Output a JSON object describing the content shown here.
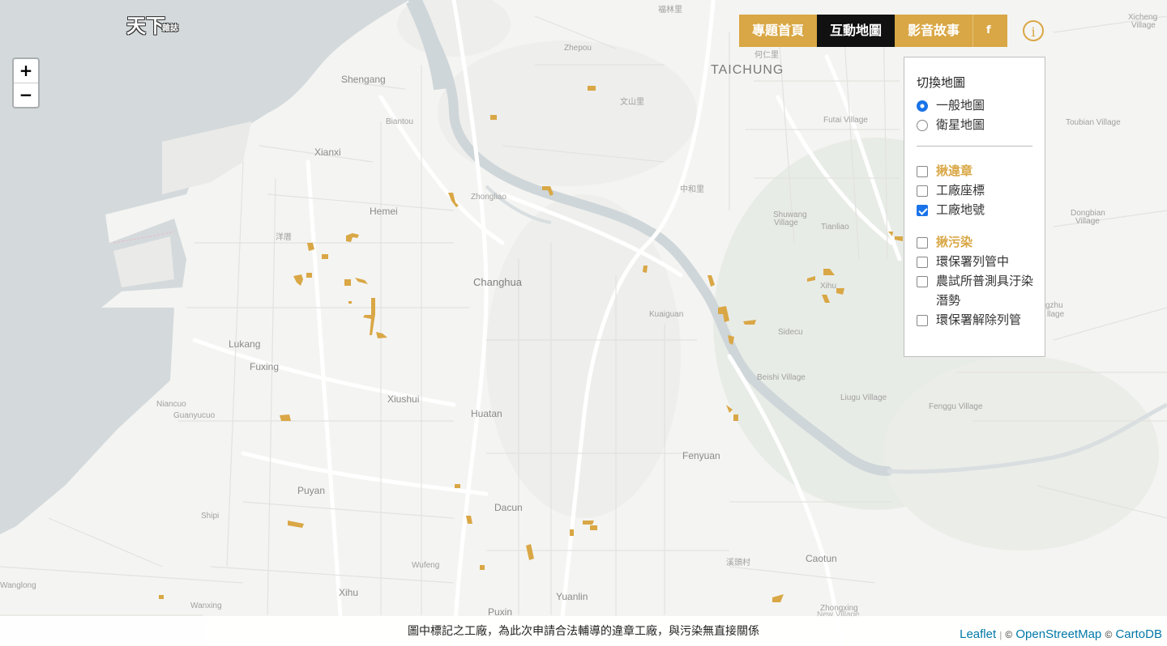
{
  "logo": {
    "main": "天下",
    "sub": "雜誌"
  },
  "zoom": {
    "in_label": "+",
    "out_label": "−"
  },
  "nav": {
    "items": [
      {
        "label": "專題首頁",
        "active": false
      },
      {
        "label": "互動地圖",
        "active": true
      },
      {
        "label": "影音故事",
        "active": false
      }
    ],
    "facebook_label": "f",
    "info_label": "i"
  },
  "layers": {
    "title": "切換地圖",
    "base_maps": [
      {
        "label": "一般地圖",
        "selected": true
      },
      {
        "label": "衛星地圖",
        "selected": false
      }
    ],
    "group1": {
      "label": "揪違章",
      "checked": false,
      "items": [
        {
          "label": "工廠座標",
          "checked": false
        },
        {
          "label": "工廠地號",
          "checked": true
        }
      ]
    },
    "group2": {
      "label": "揪污染",
      "checked": false,
      "items": [
        {
          "label": "環保署列管中",
          "checked": false
        },
        {
          "label": "農試所普測具汙染潛勢",
          "checked": false
        },
        {
          "label": "環保署解除列管",
          "checked": false
        }
      ]
    }
  },
  "footer": {
    "caption": "圖中標記之工廠，為此次申請合法輔導的違章工廠，與污染無直接關係",
    "attribution": {
      "leaflet": "Leaflet",
      "osm": "OpenStreetMap",
      "carto": "CartoDB",
      "sep": "|",
      "copy": "©"
    }
  },
  "colors": {
    "accent": "#d9a745",
    "nav_active": "#111111",
    "water": "#d4dadc",
    "land": "#f4f4f2"
  },
  "map": {
    "places": [
      {
        "name": "TAICHUNG",
        "cls": "big"
      },
      {
        "name": "Shengang",
        "cls": ""
      },
      {
        "name": "Zhepou",
        "cls": "small"
      },
      {
        "name": "Biantou",
        "cls": "small"
      },
      {
        "name": "Xianxi",
        "cls": ""
      },
      {
        "name": "Hemei",
        "cls": ""
      },
      {
        "name": "Zhongliao",
        "cls": "small"
      },
      {
        "name": "Changhua",
        "cls": "mid"
      },
      {
        "name": "Lukang",
        "cls": ""
      },
      {
        "name": "Fuxing",
        "cls": ""
      },
      {
        "name": "Xiushui",
        "cls": ""
      },
      {
        "name": "Huatan",
        "cls": ""
      },
      {
        "name": "Niancuo",
        "cls": "small"
      },
      {
        "name": "Guanyucuo",
        "cls": "small"
      },
      {
        "name": "Puyan",
        "cls": ""
      },
      {
        "name": "Shipi",
        "cls": "small"
      },
      {
        "name": "Dacun",
        "cls": ""
      },
      {
        "name": "Wufeng",
        "cls": "small"
      },
      {
        "name": "Xihu",
        "cls": ""
      },
      {
        "name": "Yuanlin",
        "cls": ""
      },
      {
        "name": "Puxin",
        "cls": ""
      },
      {
        "name": "Wanxing",
        "cls": "small"
      },
      {
        "name": "Wanglong",
        "cls": "small"
      },
      {
        "name": "Kuaiguan",
        "cls": "small"
      },
      {
        "name": "Fenyuan",
        "cls": ""
      },
      {
        "name": "Caotun",
        "cls": ""
      },
      {
        "name": "Zhongxing",
        "cls": "small"
      },
      {
        "name": "New Village",
        "cls": "light"
      },
      {
        "name": "Futai Village",
        "cls": "small"
      },
      {
        "name": "Shuwang",
        "cls": "small"
      },
      {
        "name": "Village",
        "cls": "small"
      },
      {
        "name": "Tianliao",
        "cls": "small"
      },
      {
        "name": "Xihu",
        "cls": "small"
      },
      {
        "name": "Sidecu",
        "cls": "small"
      },
      {
        "name": "Beishi Village",
        "cls": "small"
      },
      {
        "name": "Liugu Village",
        "cls": "small"
      },
      {
        "name": "Fenggu Village",
        "cls": "small"
      },
      {
        "name": "Xicheng",
        "cls": "small"
      },
      {
        "name": "Village",
        "cls": "small"
      },
      {
        "name": "Toubian Village",
        "cls": "small"
      },
      {
        "name": "Dongbian",
        "cls": "small"
      },
      {
        "name": "Village",
        "cls": "small"
      },
      {
        "name": "gzhu",
        "cls": "small"
      },
      {
        "name": "llage",
        "cls": "small"
      },
      {
        "name": "福林里",
        "cls": "small"
      },
      {
        "name": "何仁里",
        "cls": "small"
      },
      {
        "name": "文山里",
        "cls": "small"
      },
      {
        "name": "中和里",
        "cls": "small"
      },
      {
        "name": "洋厝",
        "cls": "small"
      },
      {
        "name": "溪頭村",
        "cls": "small"
      }
    ]
  }
}
